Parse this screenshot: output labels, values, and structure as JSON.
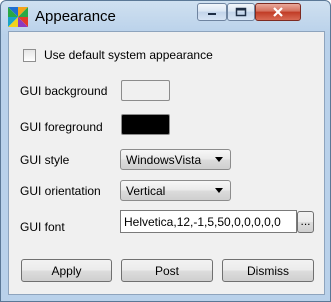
{
  "window": {
    "title": "Appearance",
    "titlebar_buttons": {
      "minimize": "minimize",
      "maximize": "maximize",
      "close": "close"
    }
  },
  "form": {
    "use_default": {
      "label": "Use default system appearance",
      "checked": false
    },
    "gui_background": {
      "label": "GUI background",
      "color": "#f0f0f0"
    },
    "gui_foreground": {
      "label": "GUI foreground",
      "color": "#000000"
    },
    "gui_style": {
      "label": "GUI style",
      "value": "WindowsVista"
    },
    "gui_orientation": {
      "label": "GUI orientation",
      "value": "Vertical"
    },
    "gui_font": {
      "label": "GUI font",
      "value": "Helvetica,12,-1,5,50,0,0,0,0,0",
      "browse_label": "..."
    }
  },
  "buttons": {
    "apply": "Apply",
    "post": "Post",
    "dismiss": "Dismiss"
  },
  "colors": {
    "window_frame": "#b9d1ea",
    "client_bg": "#f0f0f0",
    "close_button": "#c13b25"
  }
}
